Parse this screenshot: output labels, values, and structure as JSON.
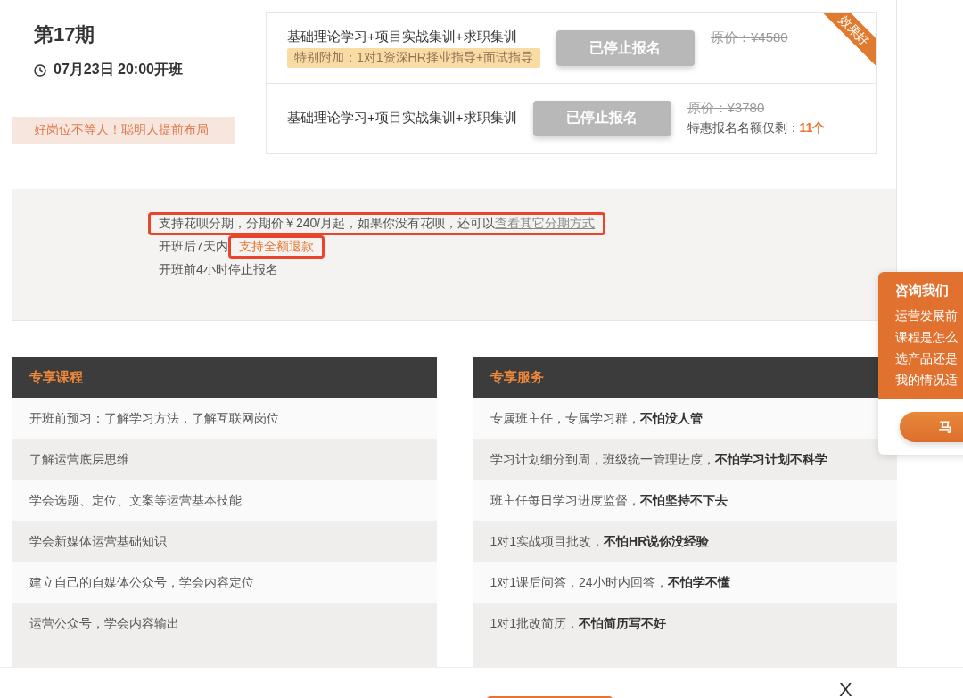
{
  "cohort": {
    "title": "第17期",
    "start": "07月23日 20:00开班",
    "slogan": "好岗位不等人！聪明人提前布局"
  },
  "plans": [
    {
      "name": "基础理论学习+项目实战集训+求职集训",
      "extra": "特别附加：1对1资深HR择业指导+面试指导",
      "button": "已停止报名",
      "disabled": true,
      "original_price": "原价：¥4580",
      "ribbon": "效果好"
    },
    {
      "name": "基础理论学习+项目实战集训+求职集训",
      "button": "已停止报名",
      "disabled": true,
      "original_price": "原价：¥3780",
      "quota_label": "特惠报名名额仅剩：",
      "quota": "11个"
    }
  ],
  "notes": [
    {
      "text": "支持花呗分期，分期价￥240/月起，如果你没有花呗，还可以",
      "link": "查看其它分期方式",
      "kind": "installment",
      "highlighted": true
    },
    {
      "text": "开班后7天内",
      "link": "支持全额退款",
      "kind": "refund",
      "highlighted": true
    },
    {
      "text": "开班前4小时停止报名",
      "kind": "plain"
    }
  ],
  "tables": [
    {
      "title": "专享课程",
      "rows": [
        "开班前预习：了解学习方法，了解互联网岗位",
        "了解运营底层思维",
        "学会选题、定位、文案等运营基本技能",
        "学会新媒体运营基础知识",
        "建立自己的自媒体公众号，学会内容定位",
        "运营公众号，学会内容输出"
      ]
    },
    {
      "title": "专享服务",
      "rows": [
        "专属班主任，专属学习群，**不怕没人管**",
        "学习计划细分到周，班级统一管理进度，**不怕学习计划不科学**",
        "班主任每日学习进度监督，**不怕坚持不下去**",
        "1对1实战项目批改，**不怕HR说你没经验**",
        "1对1课后问答，24小时内回答，**不怕学不懂**",
        "1对1批改简历，**不怕简历写不好**"
      ]
    }
  ],
  "consult": {
    "title": "咨询我们",
    "lines": [
      "运营发展前",
      "课程是怎么",
      "选产品还是",
      "我的情况适"
    ],
    "button": "马"
  },
  "bottom_bar": {
    "close": "X"
  }
}
